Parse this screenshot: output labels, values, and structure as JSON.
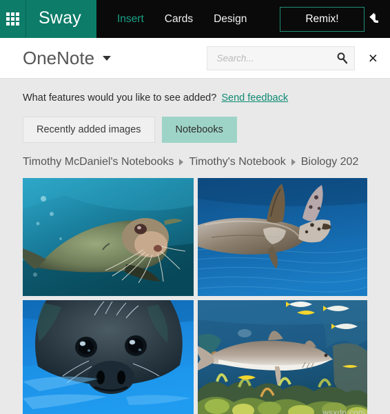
{
  "appbar": {
    "waffle_icon": "app-launcher-waffle-icon",
    "brand": "Sway",
    "nav": [
      {
        "label": "Insert",
        "active": true
      },
      {
        "label": "Cards",
        "active": false
      },
      {
        "label": "Design",
        "active": false
      }
    ],
    "remix_label": "Remix!",
    "undo_icon": "undo-arrow-icon",
    "colors": {
      "brand_teal": "#0d7c68",
      "bar_black": "#0a0a0a",
      "active_nav": "#18a287",
      "remix_border": "#1f8f77"
    }
  },
  "subheader": {
    "source_title": "OneNote",
    "dropdown_icon": "chevron-down-icon",
    "search": {
      "value": "",
      "placeholder": "Search...",
      "icon": "search-magnifier-icon"
    },
    "close_label": "×"
  },
  "content": {
    "feedback": {
      "prompt": "What features would you like to see added?",
      "link": "Send feedback",
      "link_color": "#0d8a72"
    },
    "tabs": [
      {
        "label": "Recently added images",
        "selected": false
      },
      {
        "label": "Notebooks",
        "selected": true
      }
    ],
    "selected_tab_color": "#9ed4c7",
    "breadcrumb": [
      "Timothy McDaniel's Notebooks",
      "Timothy's Notebook",
      "Biology 202"
    ],
    "breadcrumb_separator_icon": "triangle-right-icon",
    "images": [
      {
        "alt": "Sea lion swimming underwater in teal water",
        "name": "image-thumb-sea-lion"
      },
      {
        "alt": "Sea turtle swimming in deep blue water",
        "name": "image-thumb-sea-turtle"
      },
      {
        "alt": "Harbor seal face close-up in bright blue water",
        "name": "image-thumb-seal-face"
      },
      {
        "alt": "Reef shark over coral reef with yellow fish",
        "name": "image-thumb-reef-shark"
      }
    ],
    "watermark": "wsxdn.com"
  }
}
